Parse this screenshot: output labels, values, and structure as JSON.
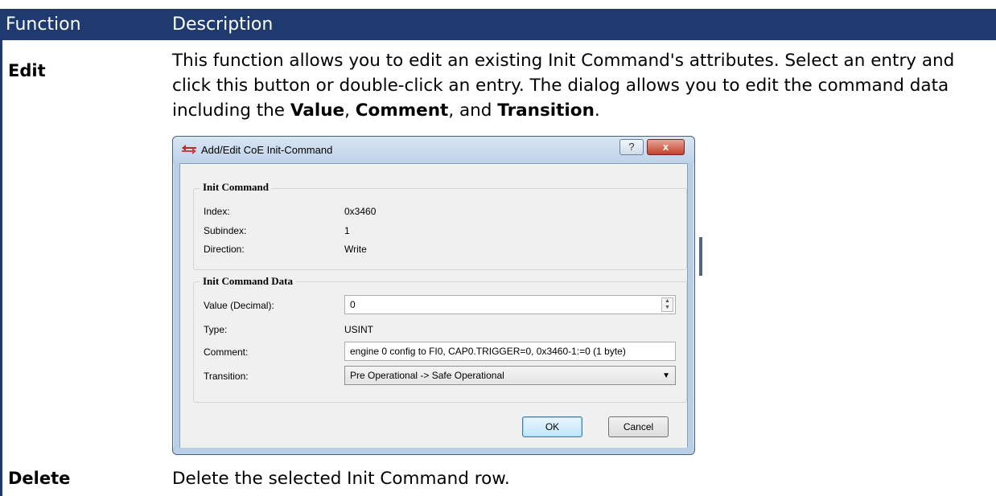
{
  "table": {
    "header": {
      "function": "Function",
      "description": "Description"
    },
    "rows": [
      {
        "function": "Edit",
        "description_parts": [
          "This function allows you to edit an existing Init Command's attributes. Select an entry and click this button or double-click an entry. The dialog allows you to edit the command data including the ",
          "Value",
          ", ",
          "Comment",
          ", and ",
          "Transition",
          "."
        ]
      },
      {
        "function": "Delete",
        "description": "Delete the selected Init Command row."
      }
    ]
  },
  "dialog": {
    "title": "Add/Edit CoE Init-Command",
    "help_label": "?",
    "close_label": "x",
    "init_command": {
      "group_title": "Init Command",
      "index_label": "Index:",
      "index_value": "0x3460",
      "subindex_label": "Subindex:",
      "subindex_value": "1",
      "direction_label": "Direction:",
      "direction_value": "Write"
    },
    "init_command_data": {
      "group_title": "Init Command Data",
      "value_label": "Value (Decimal):",
      "value": "0",
      "type_label": "Type:",
      "type_value": "USINT",
      "comment_label": "Comment:",
      "comment_value": "engine 0 config to FI0, CAP0.TRIGGER=0, 0x3460-1:=0 (1 byte)",
      "transition_label": "Transition:",
      "transition_value": "Pre Operational -> Safe Operational"
    },
    "ok_label": "OK",
    "cancel_label": "Cancel"
  },
  "colors": {
    "header_bg": "#1f3a6e",
    "dialog_frame": "#b9cfe6",
    "close_button": "#c2412b"
  }
}
